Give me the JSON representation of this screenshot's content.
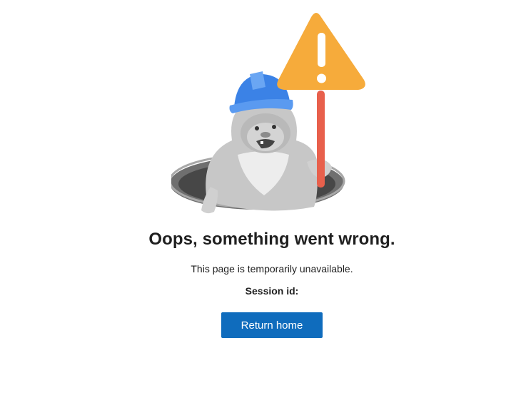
{
  "error": {
    "title": "Oops, something went wrong.",
    "message": "This page is temporarily unavailable.",
    "session_label": "Session id:",
    "session_value": "",
    "return_button_label": "Return home"
  },
  "illustration": {
    "name": "yeti-in-manhole-with-warning-sign",
    "sign_symbol": "!",
    "colors": {
      "helmet": "#3b82e6",
      "sign": "#f6ab3b",
      "pole": "#e8604c",
      "fur": "#c9c9c9",
      "hole": "#5a5a5a",
      "button": "#0f6cbd"
    }
  }
}
